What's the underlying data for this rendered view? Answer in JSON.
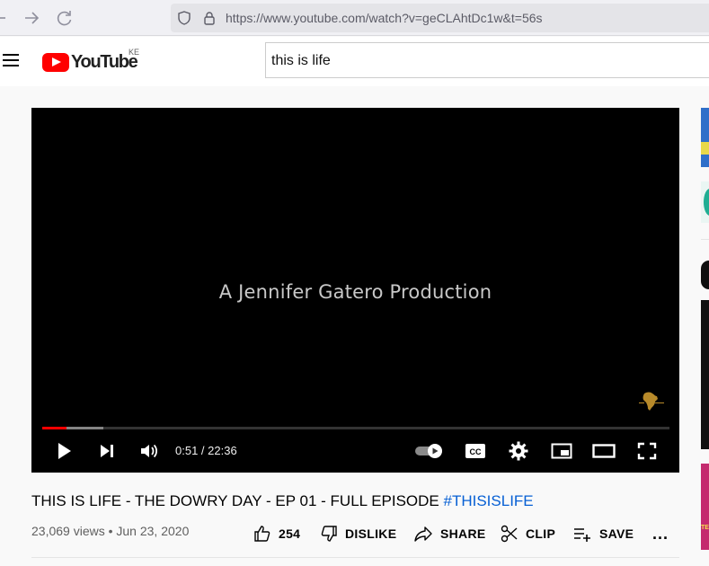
{
  "browser": {
    "url": "https://www.youtube.com/watch?v=geCLAhtDc1w&t=56s"
  },
  "masthead": {
    "logo_text": "YouTube",
    "country_code": "KE",
    "search_value": "this is life"
  },
  "player": {
    "caption": "A Jennifer Gatero Production",
    "current_time": "0:51",
    "duration": "22:36",
    "time_display": "0:51 / 22:36",
    "played_fraction": 0.038,
    "buffered_fraction": 0.097
  },
  "video": {
    "title": "THIS IS LIFE - THE DOWRY DAY - EP 01 - FULL EPISODE ",
    "hashtag": "#THISISLIFE",
    "views": "23,069 views",
    "date": "Jun 23, 2020",
    "meta": "23,069 views • Jun 23, 2020"
  },
  "actions": {
    "like_count": "254",
    "dislike_label": "DISLIKE",
    "share_label": "SHARE",
    "clip_label": "CLIP",
    "save_label": "SAVE",
    "more_label": "..."
  },
  "sidebar": {
    "partial_text": "TE"
  },
  "colors": {
    "accent": "#ff0000",
    "link": "#065fd4",
    "player_bg": "#000000"
  }
}
